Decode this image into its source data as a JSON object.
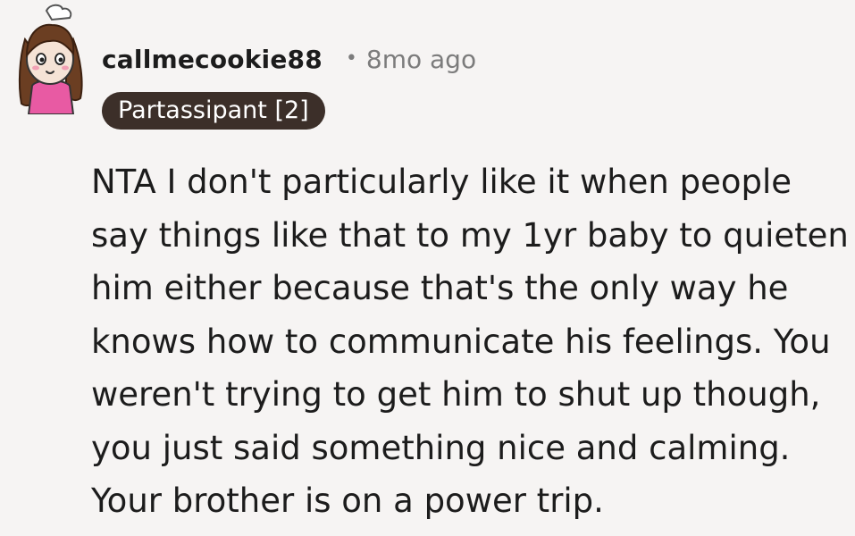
{
  "comment": {
    "author": "callmecookie88",
    "separator": "•",
    "time_ago": "8mo ago",
    "flair": "Partassipant [2]",
    "body_lines": [
      "NTA I don't particularly like it when people",
      "say things like that to my 1yr baby to quieten",
      "him either because that's the only way he",
      "knows how to communicate his feelings. You",
      "weren't trying to get him to shut up though,",
      "you just said something nice and calming.",
      "Your brother is on a power trip."
    ]
  },
  "avatar": {
    "icon": "user-avatar-girl-icon"
  },
  "colors": {
    "background": "#f6f4f3",
    "text": "#1c1c1c",
    "meta": "#7c7c7c",
    "flair_bg": "#3c2f29",
    "flair_text": "#ffffff"
  }
}
